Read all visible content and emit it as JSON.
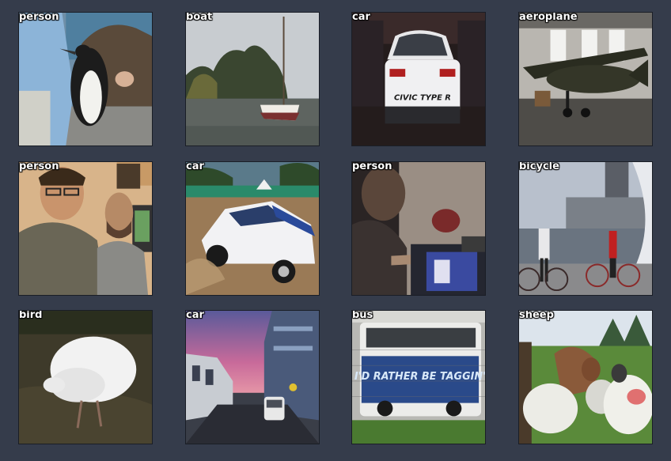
{
  "tiles": [
    {
      "label": "person"
    },
    {
      "label": "boat"
    },
    {
      "label": "car"
    },
    {
      "label": "aeroplane"
    },
    {
      "label": "person"
    },
    {
      "label": "car"
    },
    {
      "label": "person"
    },
    {
      "label": "bicycle"
    },
    {
      "label": "bird"
    },
    {
      "label": "car"
    },
    {
      "label": "bus"
    },
    {
      "label": "sheep"
    }
  ],
  "images": {
    "car_plate_text": "CIVIC TYPE R",
    "bus_graffiti_text": "I'D RATHER BE TAGGIN'"
  },
  "colors": {
    "background": "#353c4b",
    "label_text": "#ffffff"
  }
}
